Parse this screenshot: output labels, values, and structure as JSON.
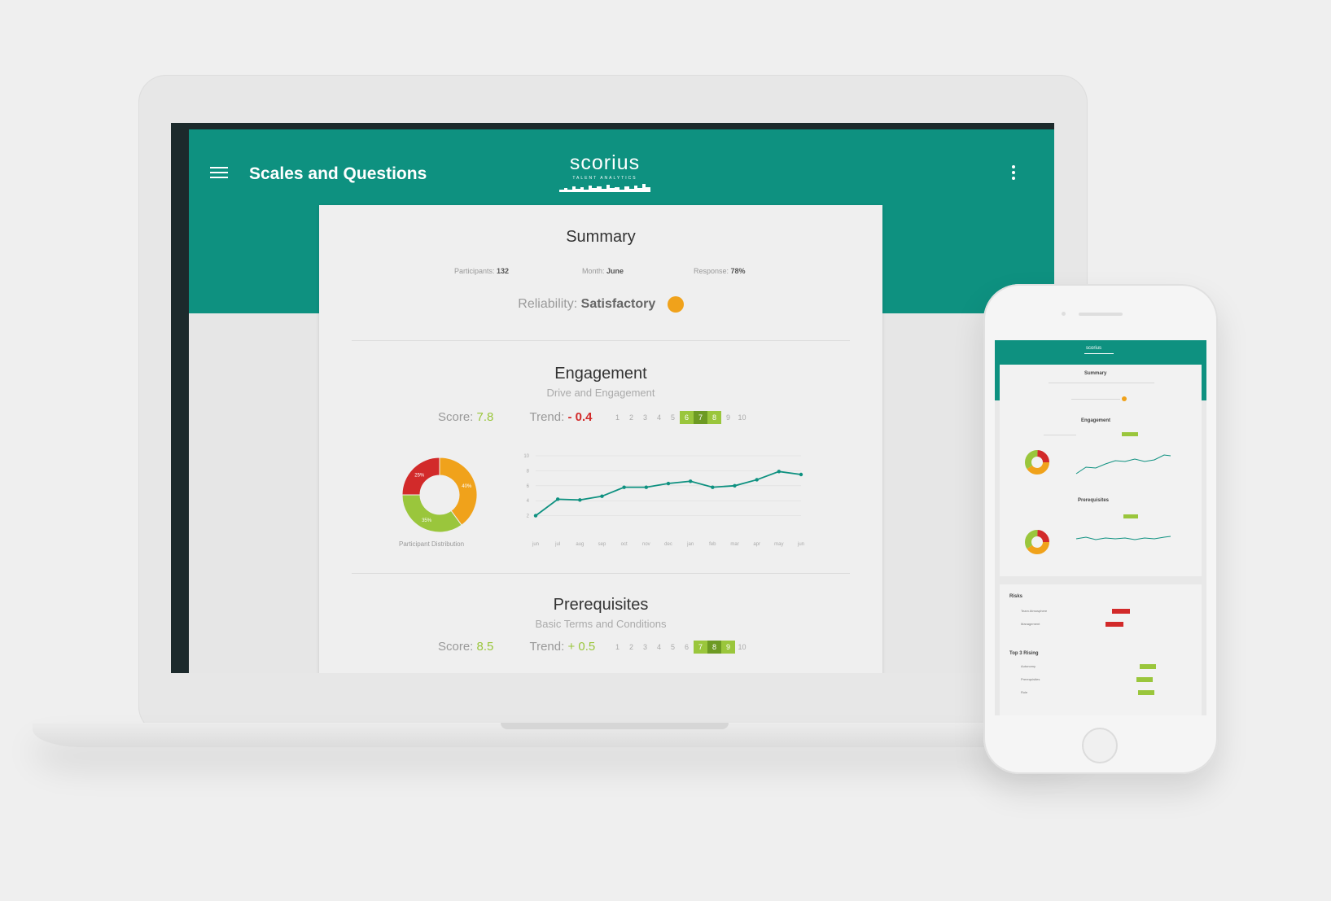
{
  "app": {
    "title": "Scales and Questions",
    "logo": "scorius",
    "logo_tagline": "TALENT ANALYTICS"
  },
  "icons": {
    "menu": "hamburger-icon",
    "more": "kebab-vertical-icon"
  },
  "colors": {
    "brand": "#0e9180",
    "good": "#9ac63c",
    "good_dark": "#6d9a23",
    "bad": "#d22a2a",
    "warning": "#f0a21b",
    "donut_orange": "#f0a21b",
    "donut_green": "#9ac63c",
    "donut_red": "#d22a2a"
  },
  "summary": {
    "title": "Summary",
    "participants_label": "Participants:",
    "participants_value": "132",
    "month_label": "Month:",
    "month_value": "June",
    "response_label": "Response:",
    "response_value": "78%",
    "reliability_label": "Reliability:",
    "reliability_value": "Satisfactory"
  },
  "engagement": {
    "title": "Engagement",
    "subtitle": "Drive and Engagement",
    "score_label": "Score:",
    "score_value": "7.8",
    "trend_label": "Trend:",
    "trend_value": "- 0.4",
    "scale": [
      "1",
      "2",
      "3",
      "4",
      "5",
      "6",
      "7",
      "8",
      "9",
      "10"
    ],
    "scale_highlight": [
      6,
      7,
      8
    ],
    "scale_selected": 7,
    "donut_label": "Participant Distribution",
    "donut_segments": [
      {
        "value": 40,
        "label": "40%",
        "color": "#f0a21b"
      },
      {
        "value": 35,
        "label": "35%",
        "color": "#9ac63c"
      },
      {
        "value": 25,
        "label": "25%",
        "color": "#d22a2a"
      }
    ]
  },
  "prerequisites": {
    "title": "Prerequisites",
    "subtitle": "Basic Terms and Conditions",
    "score_label": "Score:",
    "score_value": "8.5",
    "trend_label": "Trend:",
    "trend_value": "+ 0.5",
    "scale": [
      "1",
      "2",
      "3",
      "4",
      "5",
      "6",
      "7",
      "8",
      "9",
      "10"
    ],
    "scale_highlight": [
      7,
      8,
      9
    ],
    "scale_selected": 8
  },
  "chart_data": {
    "type": "line",
    "x": [
      "jun",
      "jul",
      "aug",
      "sep",
      "oct",
      "nov",
      "dec",
      "jan",
      "feb",
      "mar",
      "apr",
      "may",
      "jun"
    ],
    "series": [
      {
        "values": [
          2.0,
          4.2,
          4.1,
          4.6,
          5.8,
          5.8,
          6.3,
          6.6,
          5.8,
          6.0,
          6.8,
          7.9,
          7.5
        ]
      }
    ],
    "yticks": [
      "10",
      "8",
      "6",
      "4",
      "2"
    ],
    "ylim": [
      0,
      10
    ],
    "grid": true
  },
  "phone": {
    "logo": "scorius",
    "summary_title": "Summary",
    "engagement_title": "Engagement",
    "prerequisites_title": "Prerequisites",
    "risks_title": "Risks",
    "risk_items": [
      "Team Atmosphere",
      "Management"
    ],
    "top_title": "Top 3 Rising",
    "top_items": [
      "Autonomy",
      "Prerequisites",
      "Role"
    ]
  }
}
